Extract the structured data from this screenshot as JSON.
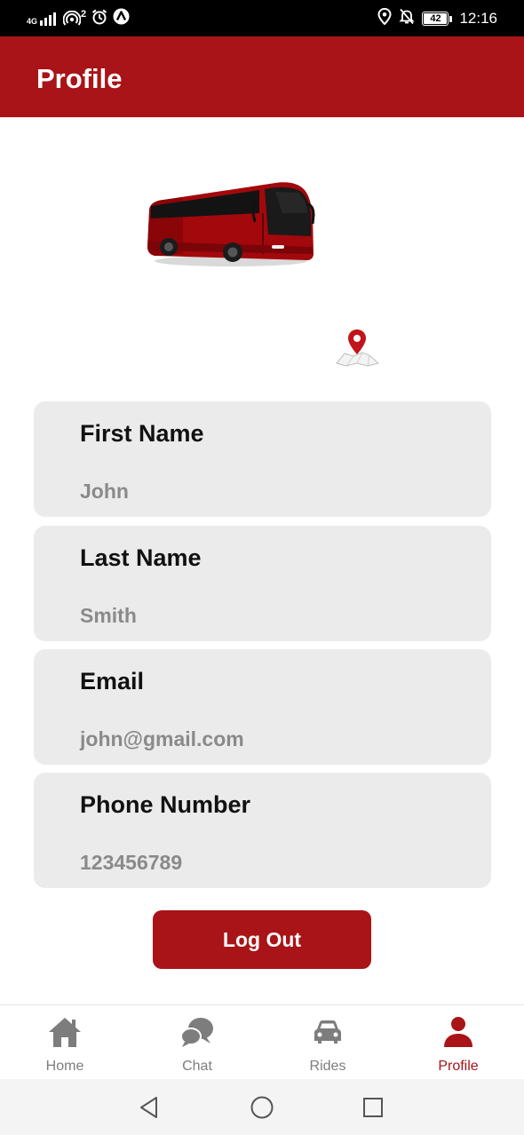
{
  "status_bar": {
    "network": "4G",
    "sim_small": "46",
    "hotspot_count": "2",
    "battery": "42",
    "time": "12:16"
  },
  "header": {
    "title": "Profile"
  },
  "profile": {
    "fields": [
      {
        "label": "First Name",
        "value": "John"
      },
      {
        "label": "Last Name",
        "value": "Smith"
      },
      {
        "label": "Email",
        "value": "john@gmail.com"
      },
      {
        "label": "Phone Number",
        "value": "123456789"
      }
    ],
    "logout_label": "Log Out"
  },
  "bottom_nav": {
    "items": [
      {
        "label": "Home",
        "icon": "home-icon"
      },
      {
        "label": "Chat",
        "icon": "chat-icon"
      },
      {
        "label": "Rides",
        "icon": "car-icon"
      },
      {
        "label": "Profile",
        "icon": "person-icon"
      }
    ],
    "active": "Profile"
  },
  "colors": {
    "accent": "#a81417",
    "card_bg": "#ebebeb",
    "value_text": "#8a8a8a",
    "nav_inactive": "#7d7d7d"
  }
}
